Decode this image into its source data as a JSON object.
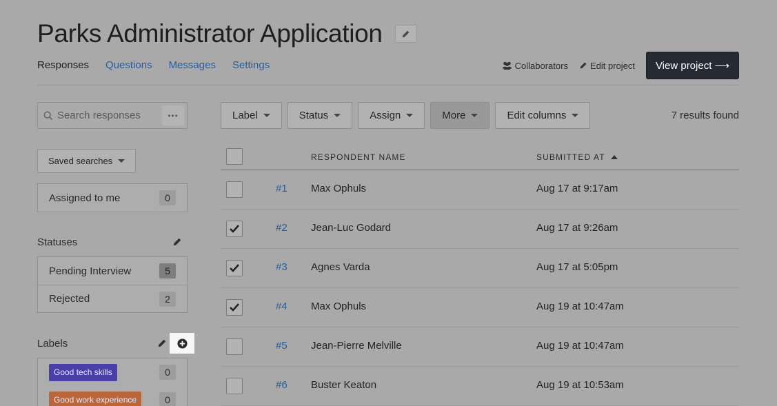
{
  "header": {
    "title": "Parks Administrator Application",
    "tabs": [
      {
        "label": "Responses",
        "active": true
      },
      {
        "label": "Questions",
        "active": false
      },
      {
        "label": "Messages",
        "active": false
      },
      {
        "label": "Settings",
        "active": false
      }
    ],
    "collaborators_label": "Collaborators",
    "edit_project_label": "Edit project",
    "view_project_label": "View project ⟶"
  },
  "sidebar": {
    "search_placeholder": "Search responses",
    "search_more": "•••",
    "saved_searches_label": "Saved searches",
    "assigned": {
      "label": "Assigned to me",
      "count": "0"
    },
    "statuses_title": "Statuses",
    "statuses": [
      {
        "label": "Pending Interview",
        "count": "5"
      },
      {
        "label": "Rejected",
        "count": "2"
      }
    ],
    "labels_title": "Labels",
    "labels": [
      {
        "label": "Good tech skills",
        "count": "0",
        "color": "#4a3fa8"
      },
      {
        "label": "Good work experience",
        "count": "0",
        "color": "#b8663a"
      }
    ]
  },
  "toolbar": {
    "label_btn": "Label",
    "status_btn": "Status",
    "assign_btn": "Assign",
    "more_btn": "More",
    "edit_columns_btn": "Edit columns",
    "results": "7 results found"
  },
  "table": {
    "col_name": "RESPONDENT NAME",
    "col_submitted": "SUBMITTED AT",
    "rows": [
      {
        "id": "#1",
        "name": "Max Ophuls",
        "submitted": "Aug 17 at 9:17am",
        "checked": false
      },
      {
        "id": "#2",
        "name": "Jean-Luc Godard",
        "submitted": "Aug 17 at 9:26am",
        "checked": true
      },
      {
        "id": "#3",
        "name": "Agnes Varda",
        "submitted": "Aug 17 at 5:05pm",
        "checked": true
      },
      {
        "id": "#4",
        "name": "Max Ophuls",
        "submitted": "Aug 19 at 10:47am",
        "checked": true
      },
      {
        "id": "#5",
        "name": "Jean-Pierre Melville",
        "submitted": "Aug 19 at 10:47am",
        "checked": false
      },
      {
        "id": "#6",
        "name": "Buster Keaton",
        "submitted": "Aug 19 at 10:53am",
        "checked": false
      }
    ]
  },
  "colors": {
    "overlay": "#a9a9a9",
    "link": "#2a5d9a",
    "primary_button": "#262a33",
    "highlight": "#f7f7f7"
  }
}
